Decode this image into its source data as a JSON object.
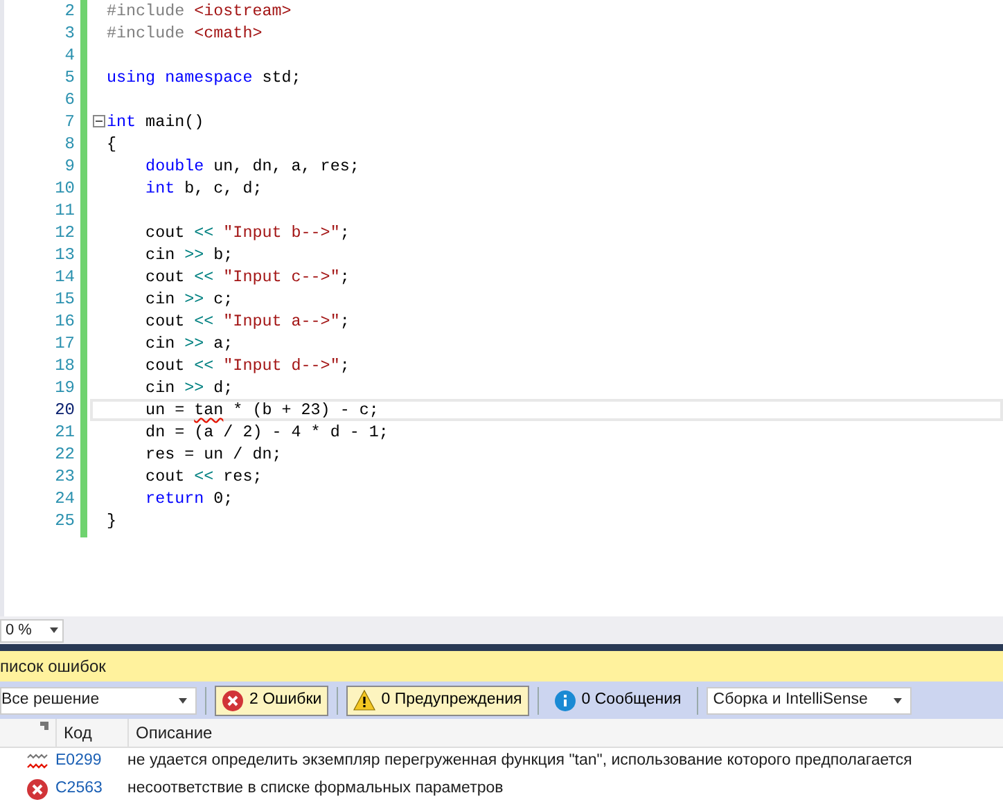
{
  "editor": {
    "lines": [
      {
        "number": "2",
        "current": false,
        "fold": false,
        "tokens": [
          {
            "kind": "pp",
            "text": "#include "
          },
          {
            "kind": "str",
            "text": "<iostream>"
          }
        ]
      },
      {
        "number": "3",
        "current": false,
        "fold": false,
        "tokens": [
          {
            "kind": "pp",
            "text": "#include "
          },
          {
            "kind": "str",
            "text": "<cmath>"
          }
        ]
      },
      {
        "number": "4",
        "current": false,
        "fold": false
      },
      {
        "number": "5",
        "current": false,
        "fold": false,
        "tokens": [
          {
            "kind": "kw",
            "text": "using namespace"
          },
          {
            "kind": "id",
            "text": " std;"
          }
        ]
      },
      {
        "number": "6",
        "current": false,
        "fold": false
      },
      {
        "number": "7",
        "current": false,
        "fold": true,
        "tokens": [
          {
            "kind": "kw",
            "text": "int"
          },
          {
            "kind": "id",
            "text": " main()"
          }
        ]
      },
      {
        "number": "8",
        "current": false,
        "fold": false,
        "tokens": [
          {
            "kind": "id",
            "text": "{"
          }
        ]
      },
      {
        "number": "9",
        "current": false,
        "fold": false,
        "tokens": [
          {
            "kind": "kw",
            "text": "    double"
          },
          {
            "kind": "id",
            "text": " un, dn, a, res;"
          }
        ]
      },
      {
        "number": "10",
        "current": false,
        "fold": false,
        "tokens": [
          {
            "kind": "kw",
            "text": "    int"
          },
          {
            "kind": "id",
            "text": " b, c, d;"
          }
        ]
      },
      {
        "number": "11",
        "current": false,
        "fold": false
      },
      {
        "number": "12",
        "current": false,
        "fold": false,
        "tokens": [
          {
            "kind": "id",
            "text": "    cout "
          },
          {
            "kind": "op",
            "text": "<<"
          },
          {
            "kind": "str",
            "text": " \"Input b-->\""
          },
          {
            "kind": "id",
            "text": ";"
          }
        ]
      },
      {
        "number": "13",
        "current": false,
        "fold": false,
        "tokens": [
          {
            "kind": "id",
            "text": "    cin "
          },
          {
            "kind": "op",
            "text": ">>"
          },
          {
            "kind": "id",
            "text": " b;"
          }
        ]
      },
      {
        "number": "14",
        "current": false,
        "fold": false,
        "tokens": [
          {
            "kind": "id",
            "text": "    cout "
          },
          {
            "kind": "op",
            "text": "<<"
          },
          {
            "kind": "str",
            "text": " \"Input c-->\""
          },
          {
            "kind": "id",
            "text": ";"
          }
        ]
      },
      {
        "number": "15",
        "current": false,
        "fold": false,
        "tokens": [
          {
            "kind": "id",
            "text": "    cin "
          },
          {
            "kind": "op",
            "text": ">>"
          },
          {
            "kind": "id",
            "text": " c;"
          }
        ]
      },
      {
        "number": "16",
        "current": false,
        "fold": false,
        "tokens": [
          {
            "kind": "id",
            "text": "    cout "
          },
          {
            "kind": "op",
            "text": "<<"
          },
          {
            "kind": "str",
            "text": " \"Input a-->\""
          },
          {
            "kind": "id",
            "text": ";"
          }
        ]
      },
      {
        "number": "17",
        "current": false,
        "fold": false,
        "tokens": [
          {
            "kind": "id",
            "text": "    cin "
          },
          {
            "kind": "op",
            "text": ">>"
          },
          {
            "kind": "id",
            "text": " a;"
          }
        ]
      },
      {
        "number": "18",
        "current": false,
        "fold": false,
        "tokens": [
          {
            "kind": "id",
            "text": "    cout "
          },
          {
            "kind": "op",
            "text": "<<"
          },
          {
            "kind": "str",
            "text": " \"Input d-->\""
          },
          {
            "kind": "id",
            "text": ";"
          }
        ]
      },
      {
        "number": "19",
        "current": false,
        "fold": false,
        "tokens": [
          {
            "kind": "id",
            "text": "    cin "
          },
          {
            "kind": "op",
            "text": ">>"
          },
          {
            "kind": "id",
            "text": " d;"
          }
        ]
      },
      {
        "number": "20",
        "current": true,
        "fold": false,
        "tokens": [
          {
            "kind": "id",
            "text": "    un = "
          },
          {
            "kind": "err",
            "text": "tan"
          },
          {
            "kind": "id",
            "text": " * (b + 23) - c;"
          }
        ]
      },
      {
        "number": "21",
        "current": false,
        "fold": false,
        "tokens": [
          {
            "kind": "id",
            "text": "    dn = (a / 2) - 4 * d - 1;"
          }
        ]
      },
      {
        "number": "22",
        "current": false,
        "fold": false,
        "tokens": [
          {
            "kind": "id",
            "text": "    res = un / dn;"
          }
        ]
      },
      {
        "number": "23",
        "current": false,
        "fold": false,
        "tokens": [
          {
            "kind": "id",
            "text": "    cout "
          },
          {
            "kind": "op",
            "text": "<<"
          },
          {
            "kind": "id",
            "text": " res;"
          }
        ]
      },
      {
        "number": "24",
        "current": false,
        "fold": false,
        "tokens": [
          {
            "kind": "kw",
            "text": "    return"
          },
          {
            "kind": "id",
            "text": " 0;"
          }
        ]
      },
      {
        "number": "25",
        "current": false,
        "fold": false,
        "tokens": [
          {
            "kind": "id",
            "text": "}"
          }
        ]
      }
    ],
    "zoom": "0 %"
  },
  "error_list": {
    "title": "писок ошибок",
    "scope": "Все решение",
    "filters": [
      {
        "kind": "error",
        "label": "2 Ошибки",
        "selected": true
      },
      {
        "kind": "warning",
        "label": "0 Предупреждения",
        "selected": true
      },
      {
        "kind": "info",
        "label": "0 Сообщения",
        "selected": false
      }
    ],
    "source": "Сборка и IntelliSense",
    "columns": [
      "Код",
      "Описание"
    ],
    "rows": [
      {
        "kind": "intellisense",
        "code": "E0299",
        "description": "не удается определить экземпляр перегруженная функция \"tan\", использование которого предполагается"
      },
      {
        "kind": "error",
        "code": "C2563",
        "description": "несоответствие в списке формальных параметров"
      }
    ]
  }
}
